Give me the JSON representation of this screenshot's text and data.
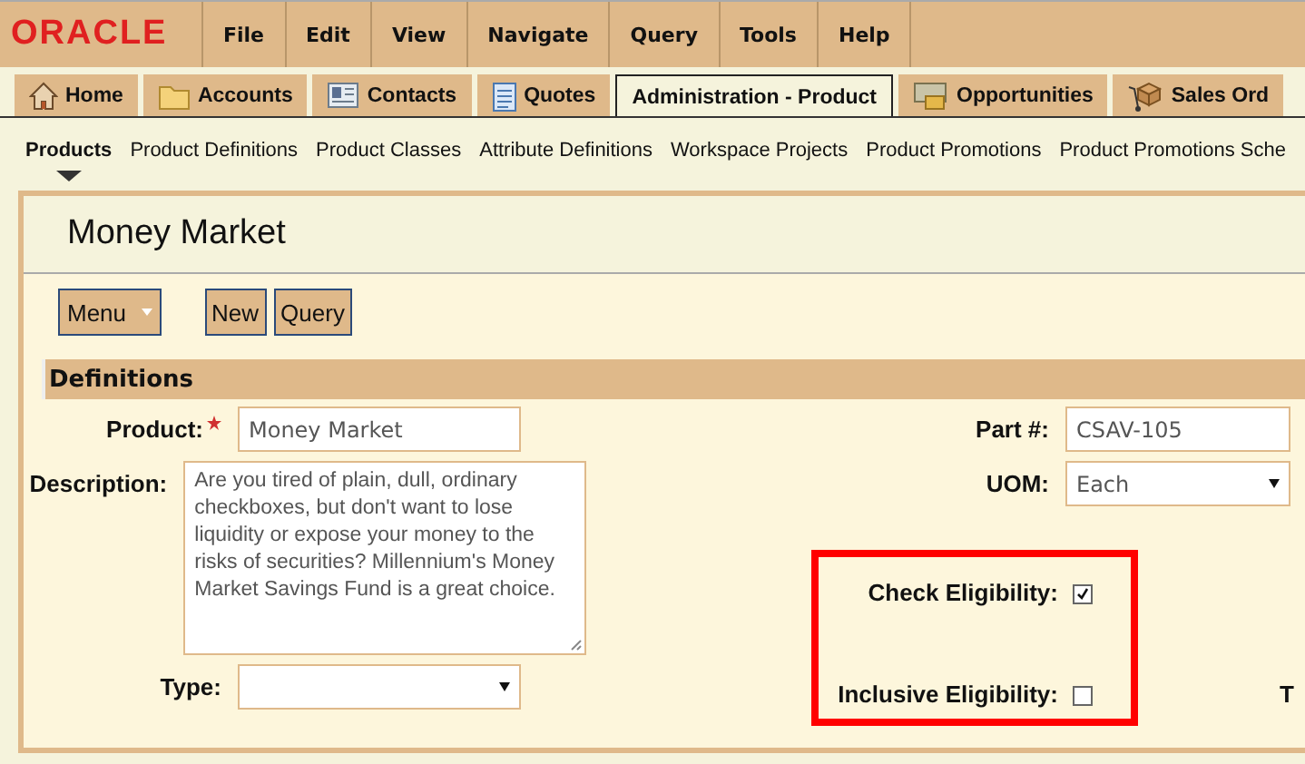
{
  "logo": "ORACLE",
  "menu": [
    "File",
    "Edit",
    "View",
    "Navigate",
    "Query",
    "Tools",
    "Help"
  ],
  "tabs": [
    {
      "label": "Home",
      "selected": false
    },
    {
      "label": "Accounts",
      "selected": false
    },
    {
      "label": "Contacts",
      "selected": false
    },
    {
      "label": "Quotes",
      "selected": false
    },
    {
      "label": "Administration - Product",
      "selected": true
    },
    {
      "label": "Opportunities",
      "selected": false
    },
    {
      "label": "Sales Ord",
      "selected": false
    }
  ],
  "subnav": [
    {
      "label": "Products",
      "selected": true
    },
    {
      "label": "Product Definitions",
      "selected": false
    },
    {
      "label": "Product Classes",
      "selected": false
    },
    {
      "label": "Attribute Definitions",
      "selected": false
    },
    {
      "label": "Workspace Projects",
      "selected": false
    },
    {
      "label": "Product Promotions",
      "selected": false
    },
    {
      "label": "Product Promotions Sche",
      "selected": false
    }
  ],
  "record": {
    "title": "Money Market",
    "buttons": [
      {
        "label": "Menu",
        "kind": "dropdown"
      },
      {
        "label": "New",
        "kind": "plain"
      },
      {
        "label": "Query",
        "kind": "plain"
      }
    ],
    "section": "Definitions",
    "left_fields": [
      {
        "kind": "text",
        "label": "Product:",
        "required": true,
        "value": "Money Market"
      },
      {
        "kind": "textarea",
        "label": "Description:",
        "value": "Are you tired of plain, dull, ordinary checkboxes, but don't want to lose liquidity or expose your money to the risks of securities? Millennium's Money Market Savings Fund is a great choice."
      },
      {
        "kind": "select",
        "label": "Type:"
      }
    ],
    "right_fields": [
      {
        "kind": "text",
        "label": "Part #:",
        "value": "CSAV-105"
      },
      {
        "kind": "select",
        "label": "UOM:",
        "value": "Each"
      }
    ],
    "highlight_box": {
      "fields": [
        {
          "label": "Check Eligibility:",
          "checked": true
        },
        {
          "label": "Inclusive Eligibility:",
          "checked": false
        }
      ]
    },
    "cut_label": "T"
  }
}
